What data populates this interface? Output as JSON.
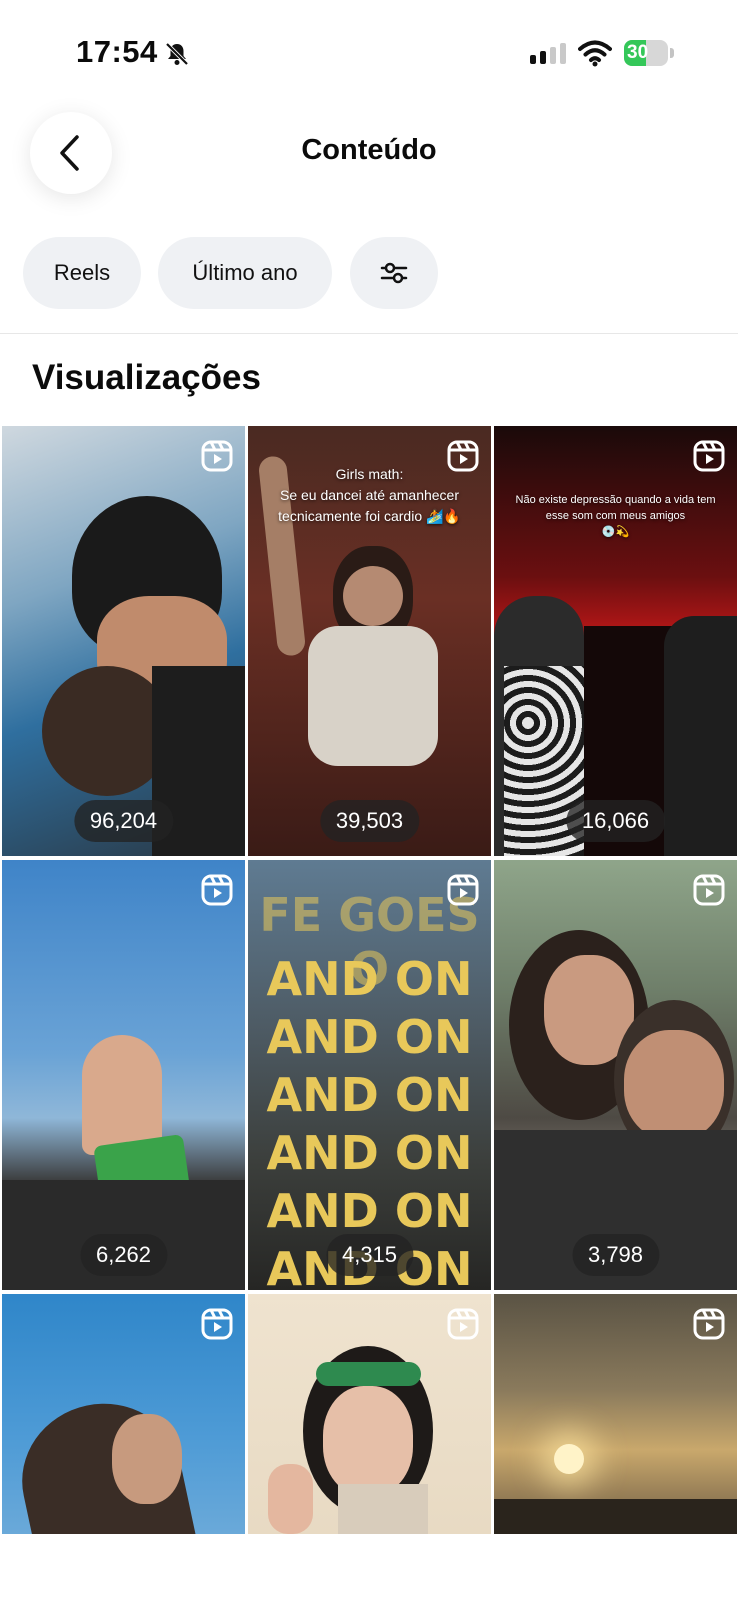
{
  "status_bar": {
    "time": "17:54",
    "battery": "30"
  },
  "header": {
    "title": "Conteúdo"
  },
  "filters": {
    "type": "Reels",
    "period": "Último ano"
  },
  "section": {
    "title": "Visualizações"
  },
  "tiles": [
    {
      "count": "96,204"
    },
    {
      "count": "39,503",
      "caption": "Girls math:\nSe eu dancei até amanhecer\ntecnicamente foi cardio 🏄🔥"
    },
    {
      "count": "16,066",
      "caption": "Não existe depressão quando a vida tem\nesse som com meus amigos\n💿💫"
    },
    {
      "count": "6,262"
    },
    {
      "count": "4,315",
      "lines": [
        "FE GOES O",
        "AND ON",
        "AND ON",
        "AND ON",
        "AND ON",
        "AND ON",
        "AND ON"
      ]
    },
    {
      "count": "3,798"
    },
    {},
    {},
    {}
  ],
  "colors": {
    "accent_green": "#34c759",
    "chip_bg": "#eff1f4",
    "pill_bg": "#232323"
  },
  "icons": [
    "chevron-left-icon",
    "bell-slash-icon",
    "signal-icon",
    "wifi-icon",
    "battery-icon",
    "sliders-icon",
    "reels-icon"
  ]
}
